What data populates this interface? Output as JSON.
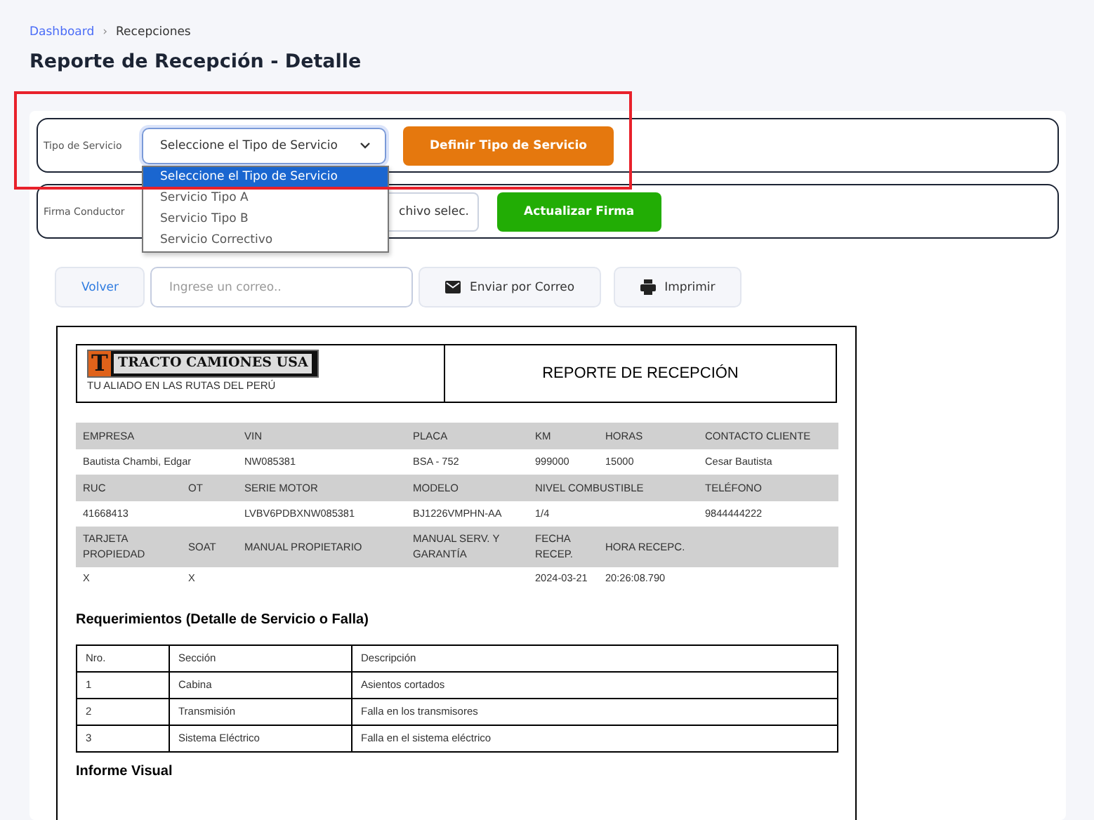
{
  "breadcrumb": [
    {
      "label": "Dashboard",
      "kind": "link"
    },
    {
      "label": "›",
      "kind": "separator"
    },
    {
      "label": "Recepciones",
      "kind": "current"
    }
  ],
  "title": "Reporte de Recepción - Detalle",
  "service_form": {
    "label": "Tipo de Servicio",
    "select": {
      "value": "Seleccione el Tipo de Servicio",
      "expanded": true,
      "options": [
        {
          "label": "Seleccione el Tipo de Servicio",
          "selected": true
        },
        {
          "label": "Servicio Tipo A",
          "selected": false
        },
        {
          "label": "Servicio Tipo B",
          "selected": false
        },
        {
          "label": "Servicio Correctivo",
          "selected": false
        }
      ]
    },
    "button": "Definir Tipo de Servicio"
  },
  "signature_form": {
    "label": "Firma Conductor",
    "file_text": "chivo selec.",
    "button": "Actualizar Firma"
  },
  "actions": {
    "back": "Volver",
    "email_placeholder": "Ingrese un correo..",
    "send": "Enviar por Correo",
    "print": "Imprimir"
  },
  "report": {
    "logo_letter": "T",
    "brand_name": "TRACTO CAMIONES USA",
    "tagline": "TU ALIADO EN LAS RUTAS DEL PERÚ",
    "title": "REPORTE DE RECEPCIÓN",
    "info_rows": [
      {
        "kind": "header",
        "cells": [
          "EMPRESA",
          null,
          "VIN",
          "PLACA",
          "KM",
          "HORAS",
          "CONTACTO CLIENTE"
        ]
      },
      {
        "kind": "value",
        "cells": [
          "Bautista Chambi, Edgar",
          null,
          "NW085381",
          "BSA - 752",
          "999000",
          "15000",
          "Cesar Bautista"
        ]
      },
      {
        "kind": "header",
        "cells": [
          "RUC",
          "OT",
          "SERIE MOTOR",
          "MODELO",
          "NIVEL COMBUSTIBLE",
          null,
          "TELÉFONO"
        ]
      },
      {
        "kind": "value",
        "cells": [
          "41668413",
          null,
          "LVBV6PDBXNW085381",
          "BJ1226VMPHN-AA",
          "1/4",
          null,
          "9844444222"
        ]
      },
      {
        "kind": "header",
        "cells": [
          "TARJETA PROPIEDAD",
          "SOAT",
          "MANUAL PROPIETARIO",
          "MANUAL SERV. Y GARANTÍA",
          "FECHA RECEP.",
          "HORA RECEPC.",
          null
        ]
      },
      {
        "kind": "value",
        "cells": [
          "X",
          "X",
          null,
          null,
          "2024-03-21",
          "20:26:08.790",
          null
        ]
      }
    ],
    "requirements": {
      "heading": "Requerimientos (Detalle de Servicio o Falla)",
      "columns": [
        "Nro.",
        "Sección",
        "Descripción"
      ],
      "rows": [
        [
          "1",
          "Cabina",
          "Asientos cortados"
        ],
        [
          "2",
          "Transmisión",
          "Falla en los transmisores"
        ],
        [
          "3",
          "Sistema Eléctrico",
          "Falla en el sistema eléctrico"
        ]
      ]
    },
    "next_heading": "Informe Visual"
  }
}
